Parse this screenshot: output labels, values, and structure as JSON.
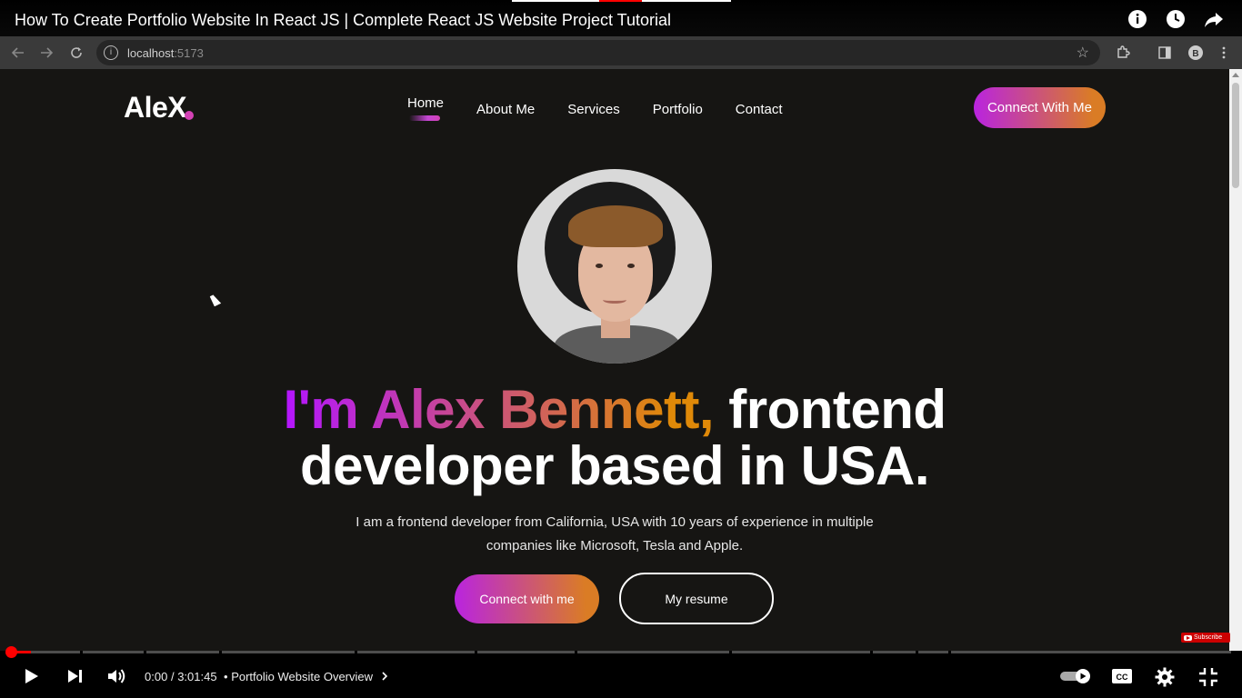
{
  "video": {
    "title": "How To Create Portfolio Website In React JS | Complete React JS Website Project Tutorial",
    "time_current": "0:00",
    "time_total": "3:01:45",
    "time_separator": "/",
    "chapter_bullet": "•",
    "chapter": "Portfolio Website Overview",
    "subscribe_label": "Subscribe",
    "progress_fraction": 0.0,
    "accent_color": "#ff0000"
  },
  "browser": {
    "url_host": "localhost",
    "url_port": ":5173"
  },
  "site": {
    "logo": "AleX",
    "nav": {
      "home": "Home",
      "about": "About Me",
      "services": "Services",
      "portfolio": "Portfolio",
      "contact": "Contact"
    },
    "header_button": "Connect With Me",
    "headline_gradient": "I'm Alex Bennett,",
    "headline_white_1": "frontend",
    "headline_white_2": "developer based in USA.",
    "description": "I am a frontend developer from California, USA with 10 years of experience in multiple companies like Microsoft, Tesla and Apple.",
    "primary_button": "Connect with me",
    "secondary_button": "My resume",
    "colors": {
      "background": "#161513",
      "gradient_start": "#b415ff",
      "gradient_end": "#df8908",
      "accent_pink": "#d342b5"
    }
  },
  "icons": {
    "info": "info-icon",
    "watch_later": "clock-icon",
    "share": "share-icon",
    "back": "arrow-left-icon",
    "forward": "arrow-right-icon",
    "reload": "reload-icon",
    "bookmark": "star-icon",
    "extensions": "puzzle-icon",
    "side_panel": "side-panel-icon",
    "profile": "profile-icon",
    "menu": "kebab-menu-icon",
    "play": "play-icon",
    "next": "next-icon",
    "volume": "volume-icon",
    "autoplay": "autoplay-toggle-icon",
    "captions": "cc-icon",
    "settings": "gear-icon",
    "exit_fullscreen": "exit-fullscreen-icon"
  }
}
